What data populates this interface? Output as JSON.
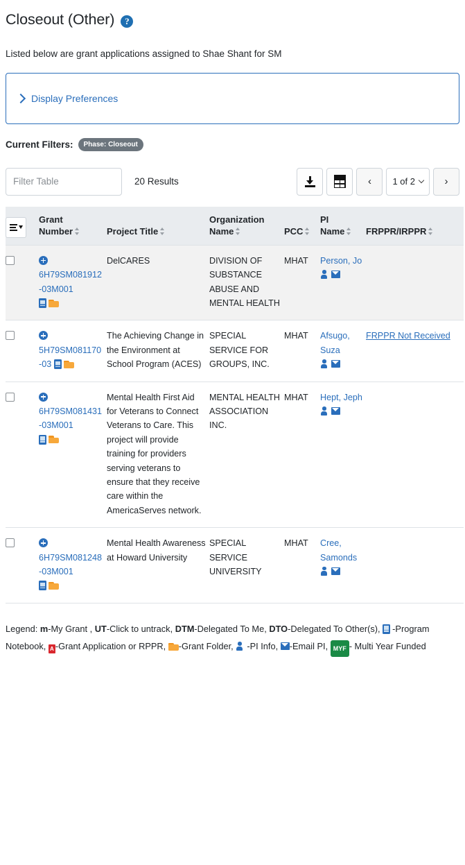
{
  "header": {
    "title": "Closeout (Other)",
    "help_icon": "help-circle-icon",
    "subtitle": "Listed below are grant applications assigned to Shae  Shant for  SM"
  },
  "display_preferences": {
    "label": "Display Preferences",
    "chevron": "chevron-right-icon",
    "expanded": false
  },
  "filters": {
    "label": "Current Filters:",
    "badges": [
      "Phase: Closeout"
    ]
  },
  "toolbar": {
    "filter_placeholder": "Filter Table",
    "filter_value": "",
    "results_text": "20 Results",
    "download_icon": "download-icon",
    "grid_icon": "table-grid-icon",
    "prev_label": "‹",
    "next_label": "›",
    "page_label": "1 of 2",
    "page_chevron": "chevron-down-icon"
  },
  "table": {
    "column_menu_icon": "column-menu-icon",
    "columns": [
      {
        "line1": "",
        "line2": "",
        "sortable": false
      },
      {
        "line1": "Grant",
        "line2": "Number",
        "sortable": true
      },
      {
        "line1": "",
        "line2": "Project Title",
        "sortable": true
      },
      {
        "line1": "Organization",
        "line2": "Name",
        "sortable": true
      },
      {
        "line1": "",
        "line2": "PCC",
        "sortable": true
      },
      {
        "line1": "PI",
        "line2": "Name",
        "sortable": true
      },
      {
        "line1": "",
        "line2": "FRPPR/IRPPR",
        "sortable": true
      }
    ],
    "rows": [
      {
        "shaded": true,
        "checked": false,
        "grant_number": "6H79SM081912-03M001",
        "project_title": "DelCARES",
        "organization_name": "DIVISION OF SUBSTANCE ABUSE AND MENTAL HEALTH",
        "pcc": "MHAT",
        "pi_name": "Person, Jo",
        "frppr": "",
        "icons": [
          "expand-icon",
          "program-notebook-icon",
          "grant-folder-icon",
          "pi-info-icon",
          "email-pi-icon"
        ]
      },
      {
        "shaded": false,
        "checked": false,
        "grant_number": "5H79SM081170-03",
        "project_title": "The Achieving Change in the Environment at School Program (ACES)",
        "organization_name": "SPECIAL SERVICE FOR GROUPS, INC.",
        "pcc": "MHAT",
        "pi_name": "Afsugo, Suza",
        "frppr": "FRPPR Not Received",
        "icons": [
          "expand-icon",
          "program-notebook-icon",
          "grant-folder-icon",
          "pi-info-icon",
          "email-pi-icon"
        ]
      },
      {
        "shaded": false,
        "checked": false,
        "grant_number": "6H79SM081431-03M001",
        "project_title": "Mental Health First Aid for Veterans to Connect Veterans to Care. This project will provide training for providers serving veterans to ensure that they receive care within the AmericaServes network.",
        "organization_name": "MENTAL HEALTH ASSOCIATION INC.",
        "pcc": "MHAT",
        "pi_name": "Hept, Jeph",
        "frppr": "",
        "icons": [
          "expand-icon",
          "program-notebook-icon",
          "grant-folder-icon",
          "pi-info-icon",
          "email-pi-icon"
        ]
      },
      {
        "shaded": false,
        "checked": false,
        "grant_number": "6H79SM081248-03M001",
        "project_title": "Mental Health Awareness at Howard University",
        "organization_name": "SPECIAL SERVICE UNIVERSITY",
        "pcc": "MHAT",
        "pi_name": "Cree, Samonds",
        "frppr": "",
        "icons": [
          "expand-icon",
          "program-notebook-icon",
          "grant-folder-icon",
          "pi-info-icon",
          "email-pi-icon"
        ]
      }
    ]
  },
  "legend": {
    "prefix": "Legend:",
    "items": [
      {
        "key": "m",
        "bold": true,
        "text": "-My Grant ,"
      },
      {
        "key": "UT",
        "bold": true,
        "text": "-Click to untrack,"
      },
      {
        "key": "DTM",
        "bold": true,
        "text": "-Delegated To Me,"
      },
      {
        "key": "DTO",
        "bold": true,
        "text": "-Delegated To Other(s),"
      },
      {
        "key": "program-notebook-icon",
        "bold": false,
        "text": "-Program Notebook,"
      },
      {
        "key": "pdf-icon",
        "bold": false,
        "text": "-Grant Application or RPPR,"
      },
      {
        "key": "grant-folder-icon",
        "bold": false,
        "text": "-Grant Folder,"
      },
      {
        "key": "pi-info-icon",
        "bold": false,
        "text": "-PI Info,"
      },
      {
        "key": "email-pi-icon",
        "bold": false,
        "text": "-Email PI,"
      },
      {
        "key": "MYF",
        "bold": false,
        "text": "- Multi Year Funded"
      }
    ],
    "t1": "-My Grant ,",
    "t2": "-Click to untrack,",
    "t3": "-Delegated To Me,",
    "t4": "-Delegated To Other(s),",
    "t5": "-Program",
    "t6": "Notebook,",
    "t7": "-Grant Application or RPPR,",
    "t8": "-Grant Folder,",
    "t9": "-PI Info,",
    "t10": "-Email PI,",
    "t11": "- Multi Year Funded",
    "b1": "m",
    "b2": "UT",
    "b3": "DTM",
    "b4": "DTO",
    "myf": "MYF",
    "pdf_letter": "A"
  },
  "colors": {
    "link": "#2a6ebb",
    "badge_bg": "#6c757d",
    "header_bg": "#e9ecef",
    "row_shaded_bg": "#f2f2f2",
    "folder": "#f7a83b",
    "myf_green": "#1a8a45",
    "pdf_red": "#d9272e"
  }
}
